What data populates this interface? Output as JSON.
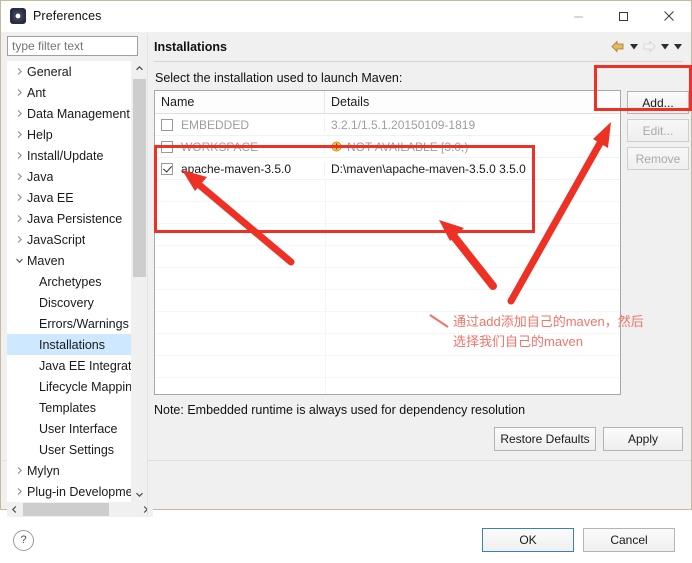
{
  "window": {
    "title": "Preferences",
    "icon": "eclipse-icon",
    "minimize_label": "minimize-icon",
    "maximize_label": "maximize-icon",
    "close_label": "close-icon"
  },
  "sidebar": {
    "filter": {
      "placeholder": "type filter text",
      "value": ""
    },
    "items": [
      {
        "label": "General",
        "level": 0,
        "expandable": true,
        "expanded": false,
        "selected": false
      },
      {
        "label": "Ant",
        "level": 0,
        "expandable": true,
        "expanded": false,
        "selected": false
      },
      {
        "label": "Data Management",
        "level": 0,
        "expandable": true,
        "expanded": false,
        "selected": false
      },
      {
        "label": "Help",
        "level": 0,
        "expandable": true,
        "expanded": false,
        "selected": false
      },
      {
        "label": "Install/Update",
        "level": 0,
        "expandable": true,
        "expanded": false,
        "selected": false
      },
      {
        "label": "Java",
        "level": 0,
        "expandable": true,
        "expanded": false,
        "selected": false
      },
      {
        "label": "Java EE",
        "level": 0,
        "expandable": true,
        "expanded": false,
        "selected": false
      },
      {
        "label": "Java Persistence",
        "level": 0,
        "expandable": true,
        "expanded": false,
        "selected": false
      },
      {
        "label": "JavaScript",
        "level": 0,
        "expandable": true,
        "expanded": false,
        "selected": false
      },
      {
        "label": "Maven",
        "level": 0,
        "expandable": true,
        "expanded": true,
        "selected": false
      },
      {
        "label": "Archetypes",
        "level": 1,
        "expandable": false,
        "expanded": false,
        "selected": false
      },
      {
        "label": "Discovery",
        "level": 1,
        "expandable": false,
        "expanded": false,
        "selected": false
      },
      {
        "label": "Errors/Warnings",
        "level": 1,
        "expandable": false,
        "expanded": false,
        "selected": false
      },
      {
        "label": "Installations",
        "level": 1,
        "expandable": false,
        "expanded": false,
        "selected": true
      },
      {
        "label": "Java EE Integration",
        "level": 1,
        "expandable": false,
        "expanded": false,
        "selected": false
      },
      {
        "label": "Lifecycle Mappings",
        "level": 1,
        "expandable": false,
        "expanded": false,
        "selected": false
      },
      {
        "label": "Templates",
        "level": 1,
        "expandable": false,
        "expanded": false,
        "selected": false
      },
      {
        "label": "User Interface",
        "level": 1,
        "expandable": false,
        "expanded": false,
        "selected": false
      },
      {
        "label": "User Settings",
        "level": 1,
        "expandable": false,
        "expanded": false,
        "selected": false
      },
      {
        "label": "Mylyn",
        "level": 0,
        "expandable": true,
        "expanded": false,
        "selected": false
      },
      {
        "label": "Plug-in Development",
        "level": 0,
        "expandable": true,
        "expanded": false,
        "selected": false
      }
    ],
    "scroll_up_icon": "chevron-up-icon",
    "scroll_down_icon": "chevron-down-icon",
    "scroll_left_icon": "chevron-left-icon",
    "scroll_right_icon": "chevron-right-icon"
  },
  "panel": {
    "title": "Installations",
    "description": "Select the installation used to launch Maven:",
    "note": "Note: Embedded runtime is always used for dependency resolution",
    "nav": {
      "back_icon": "back-arrow-icon",
      "back_menu_icon": "caret-down-icon",
      "forward_icon": "forward-arrow-icon",
      "forward_menu_icon": "caret-down-icon",
      "view_menu_icon": "caret-down-icon"
    }
  },
  "table": {
    "columns": [
      "Name",
      "Details"
    ],
    "rows": [
      {
        "checked": false,
        "name": "EMBEDDED",
        "details": "3.2.1/1.5.1.20150109-1819",
        "dim": true,
        "warning": false
      },
      {
        "checked": false,
        "name": "WORKSPACE",
        "details": "NOT AVAILABLE [3.0,)",
        "dim": true,
        "warning": true
      },
      {
        "checked": true,
        "name": "apache-maven-3.5.0",
        "details": "D:\\maven\\apache-maven-3.5.0 3.5.0",
        "dim": false,
        "warning": false
      }
    ]
  },
  "buttons": {
    "add": {
      "label": "Add...",
      "mnemonic": "A",
      "enabled": true
    },
    "edit": {
      "label": "Edit...",
      "mnemonic": "E",
      "enabled": false
    },
    "remove": {
      "label": "Remove",
      "mnemonic": "R",
      "enabled": false
    },
    "restore_defaults": {
      "label": "Restore Defaults",
      "mnemonic": "D",
      "enabled": true
    },
    "apply": {
      "label": "Apply",
      "mnemonic": "A",
      "enabled": true
    },
    "ok": {
      "label": "OK",
      "enabled": true,
      "default": true
    },
    "cancel": {
      "label": "Cancel",
      "enabled": true
    },
    "help": {
      "label": "?",
      "enabled": true
    }
  },
  "annotations": {
    "color": "#ee3124",
    "text_color": "#f2736a",
    "line1": "通过add添加自己的maven，然后",
    "line2": "选择我们自己的maven"
  }
}
